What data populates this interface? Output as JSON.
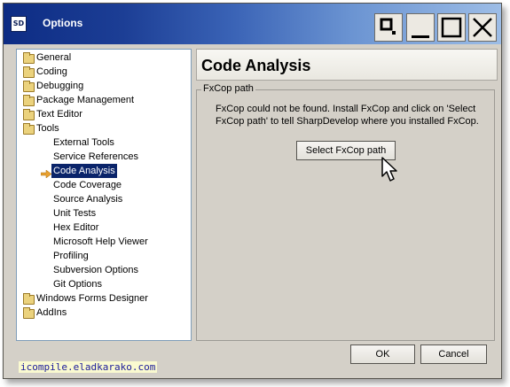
{
  "window": {
    "title": "Options",
    "icon_label": "SD",
    "controls": [
      "restore-icon",
      "minimize-icon",
      "maximize-icon",
      "close-icon"
    ]
  },
  "tree": {
    "items": [
      {
        "label": "General",
        "level": 0,
        "folder": true
      },
      {
        "label": "Coding",
        "level": 0,
        "folder": true
      },
      {
        "label": "Debugging",
        "level": 0,
        "folder": true
      },
      {
        "label": "Package Management",
        "level": 0,
        "folder": true
      },
      {
        "label": "Text Editor",
        "level": 0,
        "folder": true
      },
      {
        "label": "Tools",
        "level": 0,
        "folder": true
      },
      {
        "label": "External Tools",
        "level": 1
      },
      {
        "label": "Service References",
        "level": 1
      },
      {
        "label": "Code Analysis",
        "level": 1,
        "selected": true
      },
      {
        "label": "Code Coverage",
        "level": 1
      },
      {
        "label": "Source Analysis",
        "level": 1
      },
      {
        "label": "Unit Tests",
        "level": 1
      },
      {
        "label": "Hex Editor",
        "level": 1
      },
      {
        "label": "Microsoft Help Viewer",
        "level": 1
      },
      {
        "label": "Profiling",
        "level": 1
      },
      {
        "label": "Subversion Options",
        "level": 1
      },
      {
        "label": "Git Options",
        "level": 1
      },
      {
        "label": "Windows Forms Designer",
        "level": 0,
        "folder": true
      },
      {
        "label": "AddIns",
        "level": 0,
        "folder": true
      }
    ]
  },
  "panel": {
    "title": "Code Analysis",
    "group_legend": "FxCop path",
    "description": "FxCop could not be found. Install FxCop and click on 'Select FxCop path' to tell SharpDevelop where you installed FxCop.",
    "select_button": "Select FxCop path"
  },
  "footer": {
    "ok": "OK",
    "cancel": "Cancel",
    "watermark": "icompile.eladkarako.com"
  },
  "colors": {
    "selection": "#0a246a",
    "dialog_face": "#d4d0c8",
    "selected_arrow": "#e8a030"
  }
}
